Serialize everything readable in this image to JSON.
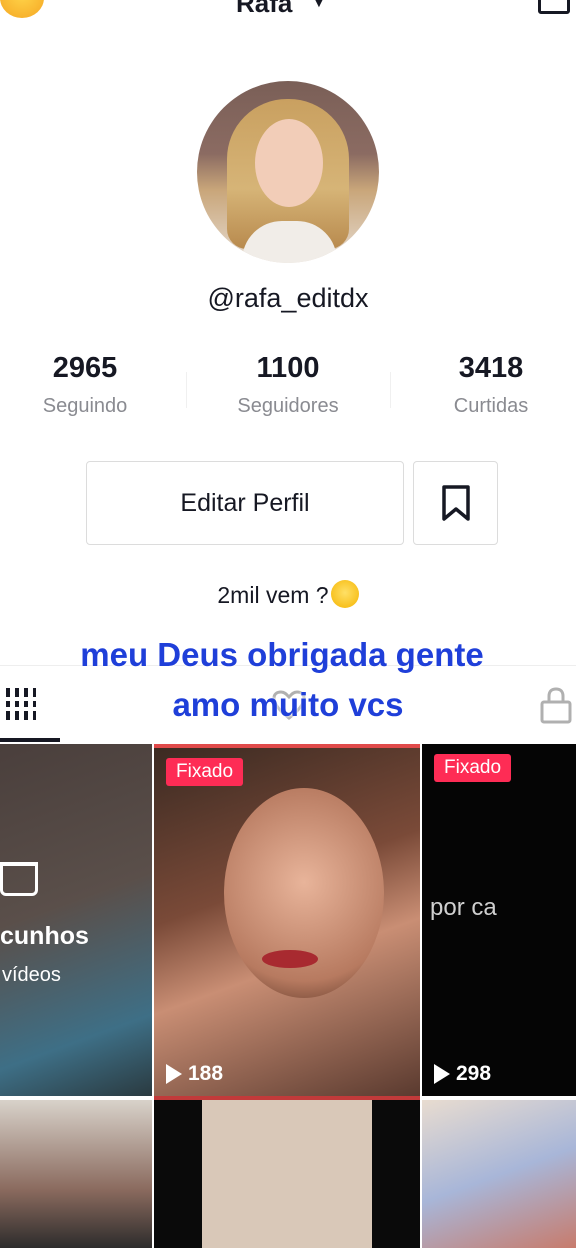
{
  "header": {
    "title": "Rafa",
    "emoji_icon": "smile-emoji-icon",
    "menu_icon": "menu-icon"
  },
  "profile": {
    "username": "@rafa_editdx",
    "stats": [
      {
        "value": "2965",
        "label": "Seguindo"
      },
      {
        "value": "1100",
        "label": "Seguidores"
      },
      {
        "value": "3418",
        "label": "Curtidas"
      }
    ],
    "edit_label": "Editar Perfil",
    "bio": "2mil  vem ?"
  },
  "overlay_caption": {
    "line1": "meu Deus obrigada gente",
    "line2": "amo muito vcs"
  },
  "tabs": [
    "grid-icon",
    "heart-icon",
    "lock-icon"
  ],
  "videos": [
    {
      "type": "drafts",
      "title": "cunhos",
      "subtitle": "vídeos"
    },
    {
      "pinned_label": "Fixado",
      "views": "188",
      "overlay_text": ""
    },
    {
      "pinned_label": "Fixado",
      "views": "298",
      "overlay_text": "por ca"
    }
  ],
  "colors": {
    "accent": "#fe2c55",
    "caption": "#1f3fd9",
    "text": "#161823",
    "muted": "#8a8b91"
  }
}
